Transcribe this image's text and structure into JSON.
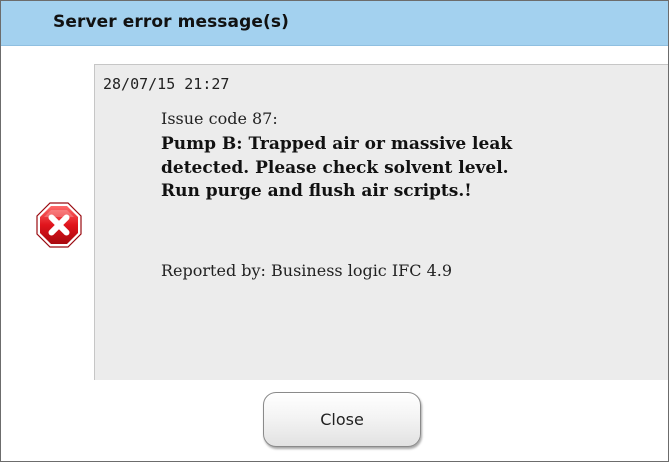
{
  "dialog": {
    "title": "Server error message(s)",
    "accent_color": "#a3d1ef",
    "icon": "error-x-icon",
    "icon_color": "#d8101a"
  },
  "message": {
    "timestamp": "28/07/15 21:27",
    "issue_code": "Issue code 87:",
    "text": "Pump B: Trapped air or massive leak detected. Please check solvent level. Run purge and flush air scripts.!",
    "reported_by": "Reported by: Business logic IFC 4.9"
  },
  "buttons": {
    "close_label": "Close"
  }
}
